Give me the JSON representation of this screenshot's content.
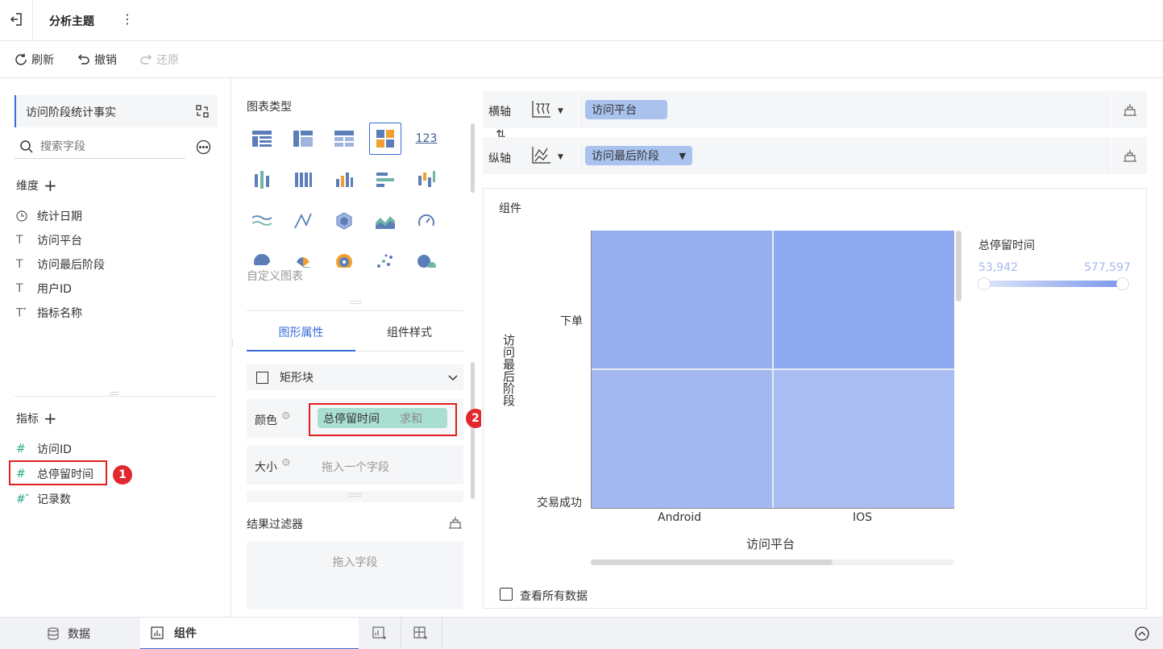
{
  "topbar": {
    "title": "分析主题",
    "more": "⋮"
  },
  "toolbar": {
    "refresh": "刷新",
    "undo": "撤销",
    "redo": "还原"
  },
  "left": {
    "dataset": "访问阶段统计事实",
    "search_placeholder": "搜索字段",
    "dimensions_label": "维度",
    "dimensions": [
      {
        "icon": "clock-icon",
        "label": "统计日期"
      },
      {
        "icon": "text-type-icon",
        "label": "访问平台"
      },
      {
        "icon": "text-type-icon",
        "label": "访问最后阶段"
      },
      {
        "icon": "text-type-icon",
        "label": "用户ID"
      },
      {
        "icon": "calc-text-type-icon",
        "label": "指标名称"
      }
    ],
    "measures_label": "指标",
    "measures": [
      {
        "icon": "number-type-icon",
        "label": "访问ID"
      },
      {
        "icon": "number-type-icon",
        "label": "总停留时间"
      },
      {
        "icon": "calc-number-type-icon",
        "label": "记录数"
      }
    ]
  },
  "middle": {
    "chart_type_label": "图表类型",
    "custom_chart": "自定义图表",
    "tab_graphic": "图形属性",
    "tab_style": "组件样式",
    "shape": "矩形块",
    "color_label": "颜色",
    "color_field": "总停留时间",
    "color_agg": "求和",
    "size_label": "大小",
    "size_placeholder": "拖入一个字段",
    "filter_label": "结果过滤器",
    "filter_placeholder": "拖入字段"
  },
  "right": {
    "x_axis_label": "横轴",
    "x_field": "访问平台",
    "y_axis_label": "纵轴",
    "y_field": "访问最后阶段",
    "component_title": "组件",
    "show_all_data": "查看所有数据"
  },
  "chart_data": {
    "type": "heatmap",
    "x_categories": [
      "Android",
      "IOS"
    ],
    "y_categories": [
      "下单",
      "交易成功"
    ],
    "xlabel": "访问平台",
    "ylabel": "访问最后阶段",
    "legend_title": "总停留时间",
    "legend_min": "53,942",
    "legend_max": "577,597",
    "cells": [
      {
        "x": "Android",
        "y": "下单",
        "color": "#98afef"
      },
      {
        "x": "IOS",
        "y": "下单",
        "color": "#8eaaf0"
      },
      {
        "x": "Android",
        "y": "交易成功",
        "color": "#a3b8f1"
      },
      {
        "x": "IOS",
        "y": "交易成功",
        "color": "#a9bdf2"
      }
    ]
  },
  "annotations": {
    "badge1": "1",
    "badge2": "2"
  },
  "bottom": {
    "data_tab": "数据",
    "component_tab": "组件"
  },
  "colors": {
    "accent": "#3a6ddb",
    "badge": "#e0282e",
    "teal": "#a8dfd0",
    "pill": "#a9c2ee"
  }
}
